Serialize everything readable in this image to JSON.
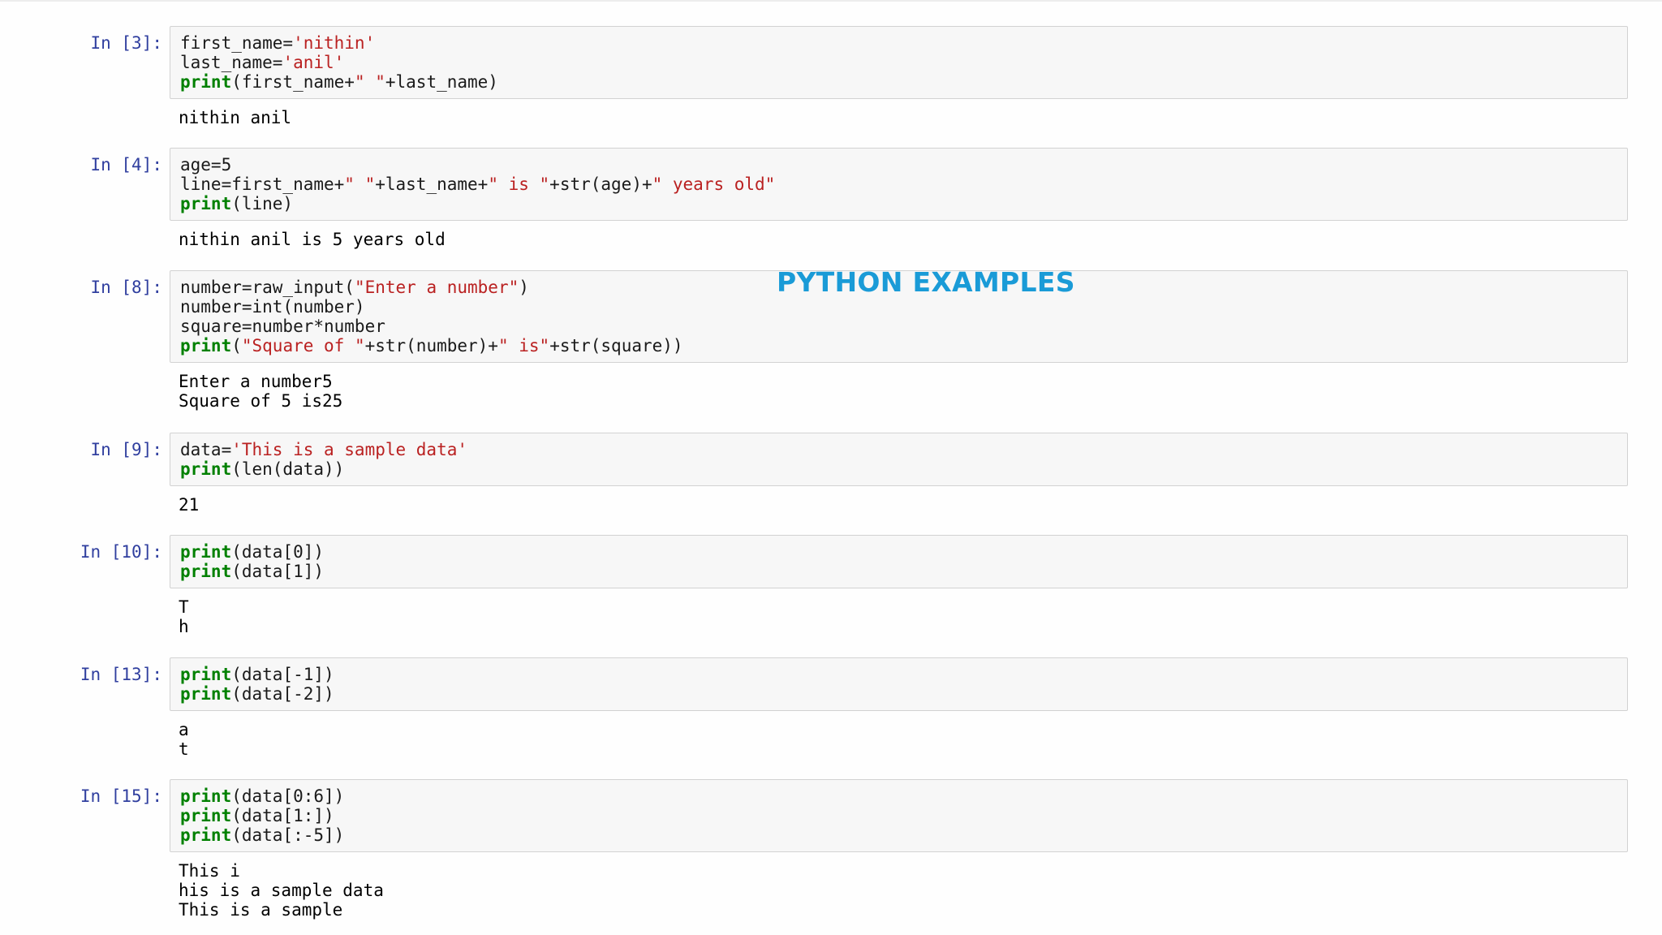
{
  "overlay_title": "PYTHON EXAMPLES",
  "colors": {
    "prompt": "#303f9f",
    "keyword": "#008000",
    "string": "#ba2121",
    "title": "#1a9bd7",
    "cell_border": "#d2d2d2",
    "cell_bg": "#f7f7f7"
  },
  "cells": [
    {
      "prompt": "In [3]:",
      "code": [
        [
          {
            "t": "first_name="
          },
          {
            "t": "'nithin'",
            "c": "str"
          }
        ],
        [
          {
            "t": "last_name="
          },
          {
            "t": "'anil'",
            "c": "str"
          }
        ],
        [
          {
            "t": "print",
            "c": "kw"
          },
          {
            "t": "(first_name+"
          },
          {
            "t": "\" \"",
            "c": "str"
          },
          {
            "t": "+last_name)"
          }
        ]
      ],
      "output": [
        "nithin anil"
      ]
    },
    {
      "prompt": "In [4]:",
      "code": [
        [
          {
            "t": "age=5"
          }
        ],
        [
          {
            "t": "line=first_name+"
          },
          {
            "t": "\" \"",
            "c": "str"
          },
          {
            "t": "+last_name+"
          },
          {
            "t": "\" is \"",
            "c": "str"
          },
          {
            "t": "+str(age)+"
          },
          {
            "t": "\" years old\"",
            "c": "str"
          }
        ],
        [
          {
            "t": "print",
            "c": "kw"
          },
          {
            "t": "(line)"
          }
        ]
      ],
      "output": [
        "nithin anil is 5 years old"
      ]
    },
    {
      "prompt": "In [8]:",
      "code": [
        [
          {
            "t": "number=raw_input("
          },
          {
            "t": "\"Enter a number\"",
            "c": "str"
          },
          {
            "t": ")"
          }
        ],
        [
          {
            "t": "number=int(number)"
          }
        ],
        [
          {
            "t": "square=number*number"
          }
        ],
        [
          {
            "t": "print",
            "c": "kw"
          },
          {
            "t": "("
          },
          {
            "t": "\"Square of \"",
            "c": "str"
          },
          {
            "t": "+str(number)+"
          },
          {
            "t": "\" is\"",
            "c": "str"
          },
          {
            "t": "+str(square))"
          }
        ]
      ],
      "output": [
        "Enter a number5",
        "Square of 5 is25"
      ]
    },
    {
      "prompt": "In [9]:",
      "code": [
        [
          {
            "t": "data="
          },
          {
            "t": "'This is a sample data'",
            "c": "str"
          }
        ],
        [
          {
            "t": "print",
            "c": "kw"
          },
          {
            "t": "(len(data))"
          }
        ]
      ],
      "output": [
        "21"
      ]
    },
    {
      "prompt": "In [10]:",
      "code": [
        [
          {
            "t": "print",
            "c": "kw"
          },
          {
            "t": "(data[0])"
          }
        ],
        [
          {
            "t": "print",
            "c": "kw"
          },
          {
            "t": "(data[1])"
          }
        ]
      ],
      "output": [
        "T",
        "h"
      ]
    },
    {
      "prompt": "In [13]:",
      "code": [
        [
          {
            "t": "print",
            "c": "kw"
          },
          {
            "t": "(data[-1])"
          }
        ],
        [
          {
            "t": "print",
            "c": "kw"
          },
          {
            "t": "(data[-2])"
          }
        ]
      ],
      "output": [
        "a",
        "t"
      ]
    },
    {
      "prompt": "In [15]:",
      "code": [
        [
          {
            "t": "print",
            "c": "kw"
          },
          {
            "t": "(data[0:6])"
          }
        ],
        [
          {
            "t": "print",
            "c": "kw"
          },
          {
            "t": "(data[1:])"
          }
        ],
        [
          {
            "t": "print",
            "c": "kw"
          },
          {
            "t": "(data[:-5])"
          }
        ]
      ],
      "output": [
        "This i",
        "his is a sample data",
        "This is a sample"
      ]
    }
  ]
}
